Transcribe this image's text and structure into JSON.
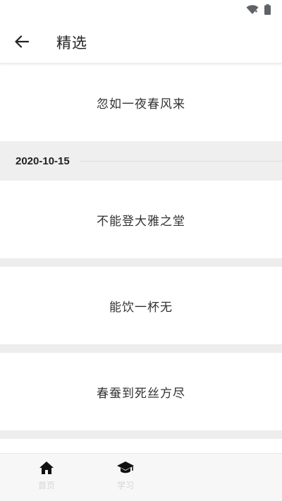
{
  "header": {
    "title": "精选"
  },
  "feed": {
    "items": [
      "忽如一夜春风来",
      "不能登大雅之堂",
      "能饮一杯无",
      "春蚕到死丝方尽"
    ],
    "date_header": "2020-10-15"
  },
  "bottom_nav": {
    "items": [
      {
        "label": "首页",
        "icon": "home-icon"
      },
      {
        "label": "学习",
        "icon": "graduation-cap-icon"
      }
    ]
  }
}
